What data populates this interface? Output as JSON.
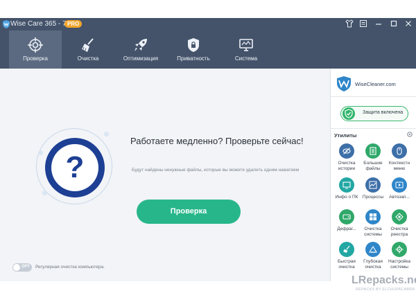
{
  "titlebar": {
    "title": "Wise Care 365 - 7.0.6",
    "badge": "PRO",
    "icons": [
      "shirt-icon",
      "menu-list-icon",
      "minimize-icon",
      "maximize-icon",
      "close-icon"
    ]
  },
  "nav": {
    "items": [
      {
        "label": "Проверка",
        "icon": "target-icon",
        "active": true
      },
      {
        "label": "Очистка",
        "icon": "broom-icon",
        "active": false
      },
      {
        "label": "Оптимизация",
        "icon": "rocket-icon",
        "active": false
      },
      {
        "label": "Приватность",
        "icon": "shield-lock-icon",
        "active": false
      },
      {
        "label": "Система",
        "icon": "monitor-icon",
        "active": false
      }
    ]
  },
  "main": {
    "question_mark": "?",
    "headline": "Работаете медленно? Проверьте сейчас!",
    "subline": "Будут найдены ненужные файлы, которые вы можете удалить одним нажатием",
    "scan_button": "Проверка",
    "toggle_state": "OFF",
    "auto_clean_label": "Регулярная очистка компьютера."
  },
  "side": {
    "brand": "WiseCleaner.com",
    "protection": "Защита включена",
    "utilities_title": "Утилиты",
    "tools": [
      {
        "label": "Очистка истории",
        "icon": "eye-slash-icon",
        "color": "#3d6fa8"
      },
      {
        "label": "Большие файлы",
        "icon": "files-icon",
        "color": "#2fa86a"
      },
      {
        "label": "Контекстн меню",
        "icon": "mouse-icon",
        "color": "#3d6fa8"
      },
      {
        "label": "Инфо о ПК",
        "icon": "pc-info-icon",
        "color": "#22a7a3"
      },
      {
        "label": "Процессы",
        "icon": "process-chart-icon",
        "color": "#3d6fa8"
      },
      {
        "label": "Автозап...",
        "icon": "play-icon",
        "color": "#2f86c9"
      },
      {
        "label": "Дефраг...",
        "icon": "hdd-icon",
        "color": "#2fa86a"
      },
      {
        "label": "Очистка системы",
        "icon": "windows-icon",
        "color": "#2f86c9"
      },
      {
        "label": "Очистка реестра",
        "icon": "registry-icon",
        "color": "#2fa86a"
      },
      {
        "label": "Быстрая очистка",
        "icon": "quick-broom-icon",
        "color": "#22a7a3"
      },
      {
        "label": "Глубокая очистка",
        "icon": "deep-clean-icon",
        "color": "#2f86c9"
      },
      {
        "label": "Настройка системы",
        "icon": "settings-tune-icon",
        "color": "#2fa86a"
      }
    ]
  },
  "watermark": {
    "main": "LRepacks.net",
    "sub": "REPACKS BY ELCHUPACABRA"
  }
}
